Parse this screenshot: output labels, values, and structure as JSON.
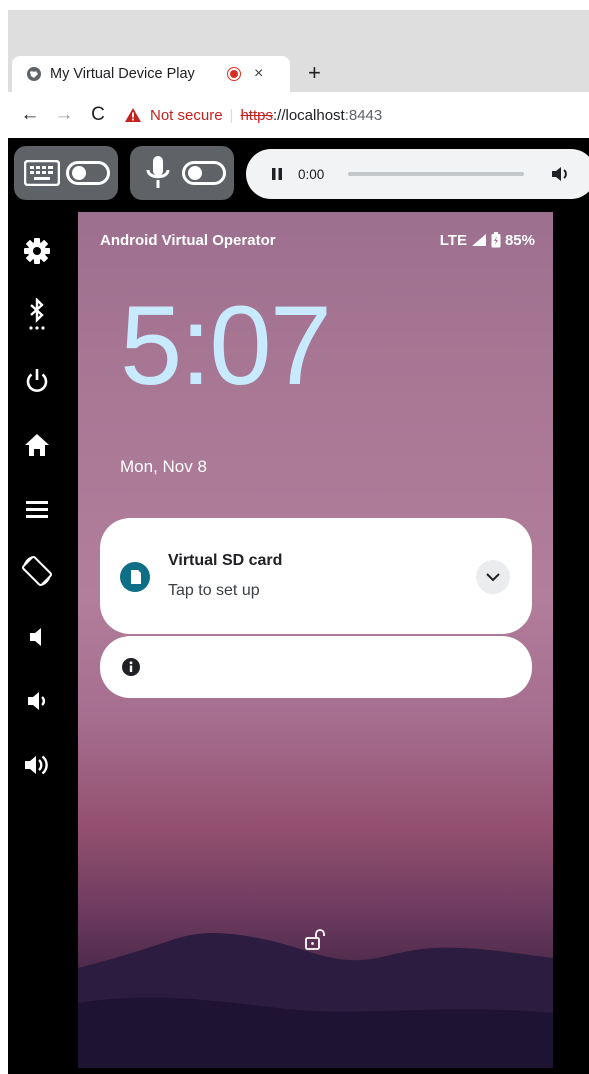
{
  "browser": {
    "tab_title": "My Virtual Device Play",
    "tab_close": "×",
    "new_tab": "+",
    "nav_back": "←",
    "nav_forward": "→",
    "nav_reload": "C",
    "security_label": "Not secure",
    "separator": "|",
    "url_scheme": "https",
    "url_sep": "://",
    "url_host": "localhost",
    "url_port": ":8443"
  },
  "player": {
    "time": "0:00"
  },
  "sidebar": {
    "icons": [
      "gear-icon",
      "bluetooth-icon",
      "power-icon",
      "home-icon",
      "menu-icon",
      "rotate-icon",
      "volume-mute-icon",
      "volume-down-icon",
      "volume-up-icon"
    ]
  },
  "device": {
    "carrier": "Android Virtual Operator",
    "network": "LTE",
    "battery": "85%",
    "time": "5:07",
    "date": "Mon, Nov 8",
    "notification": {
      "title": "Virtual SD card",
      "subtitle": "Tap to set up"
    }
  },
  "colors": {
    "accent_teal": "#0e6e86",
    "clock": "#c8eaff",
    "not_secure": "#c5221f"
  }
}
